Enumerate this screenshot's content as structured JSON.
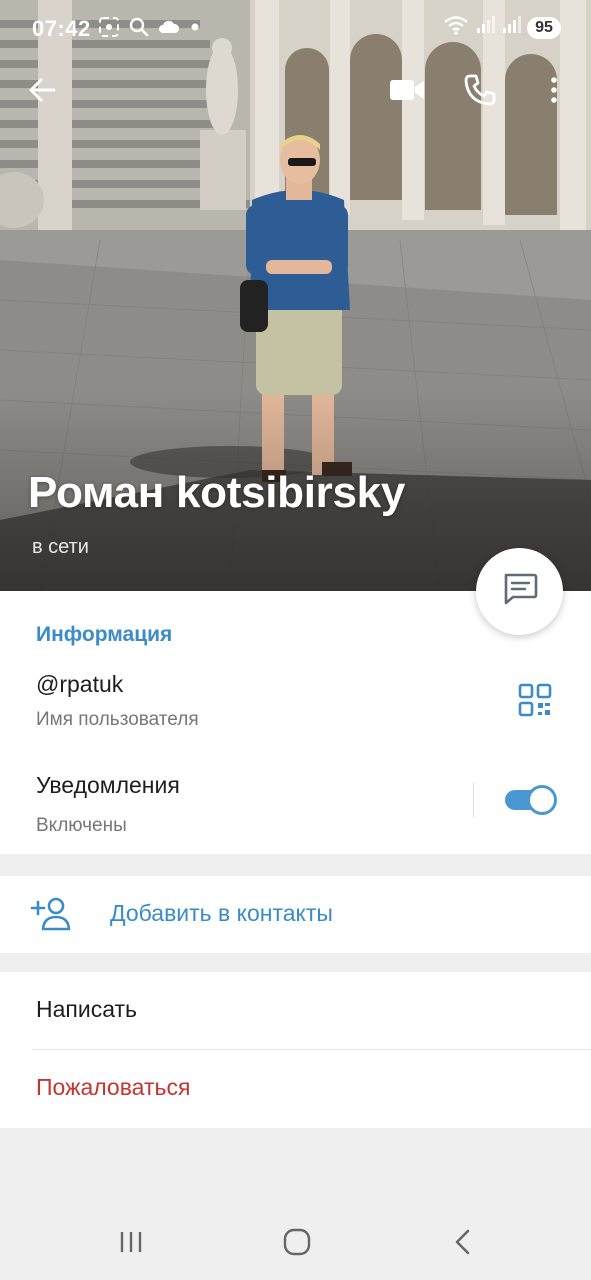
{
  "status_bar": {
    "time": "07:42",
    "battery": "95",
    "icons_left": [
      "screenshot-icon",
      "search-icon",
      "cloud-icon",
      "dot-icon"
    ],
    "icons_right": [
      "wifi-icon",
      "signal-icon",
      "signal-icon",
      "battery-badge"
    ]
  },
  "appbar": {
    "icons": [
      "back-arrow-icon",
      "video-call-icon",
      "phone-icon",
      "more-vertical-icon"
    ]
  },
  "profile": {
    "name": "Роман kotsibirsky",
    "status": "в сети"
  },
  "info": {
    "title": "Информация",
    "username": "@rpatuk",
    "username_label": "Имя пользователя",
    "notifications": "Уведомления",
    "notifications_state": "Включены",
    "notifications_on": true
  },
  "add_contact": {
    "label": "Добавить в контакты"
  },
  "actions": {
    "write": "Написать",
    "report": "Пожаловаться"
  },
  "colors": {
    "accent": "#3a8bc9",
    "toggle": "#4a97d4",
    "danger": "#c8332f",
    "background": "#efeff0"
  }
}
